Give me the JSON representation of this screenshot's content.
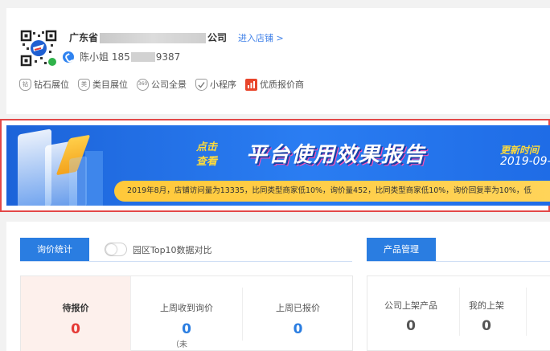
{
  "company": {
    "name_prefix": "广东省",
    "name_suffix": "公司",
    "shop_link": "进入店铺 >",
    "contact_name_prefix": "陈小姐 185",
    "contact_phone_suffix": "9387",
    "badges": [
      {
        "icon": "diamond-icon",
        "glyph": "钻",
        "label": "钻石展位"
      },
      {
        "icon": "category-icon",
        "glyph": "类",
        "label": "类目展位"
      },
      {
        "icon": "panorama-360-icon",
        "glyph": "360",
        "label": "公司全景"
      },
      {
        "icon": "mini-program-icon",
        "glyph": "",
        "label": "小程序"
      },
      {
        "icon": "quality-quote-icon",
        "glyph": "",
        "label": "优质报价商"
      }
    ]
  },
  "banner": {
    "click_line1": "点击",
    "click_line2": "查看",
    "title": "平台使用效果报告",
    "update_label": "更新时间",
    "update_date": "2019-09-",
    "stats_text": "2019年8月，店铺访问量为13335，比同类型商家低10%，询价量452，比同类型商家低10%，询价回复率为10%，低"
  },
  "inquiry": {
    "tab_label": "询价统计",
    "toggle_label": "园区Top10数据对比",
    "stats": [
      {
        "label": "待报价",
        "value": "0"
      },
      {
        "label": "上周收到询价",
        "value": "0"
      },
      {
        "label": "上周已报价",
        "value": "0"
      }
    ]
  },
  "product": {
    "tab_label": "产品管理",
    "stats": [
      {
        "label": "公司上架产品",
        "value": "0"
      },
      {
        "label": "我的上架",
        "value": "0"
      }
    ],
    "note": "（未"
  },
  "colors": {
    "accent": "#2a7de1",
    "pending_red": "#e53935",
    "banner_highlight": "#ffdb3b",
    "frame_red": "#e34848"
  }
}
